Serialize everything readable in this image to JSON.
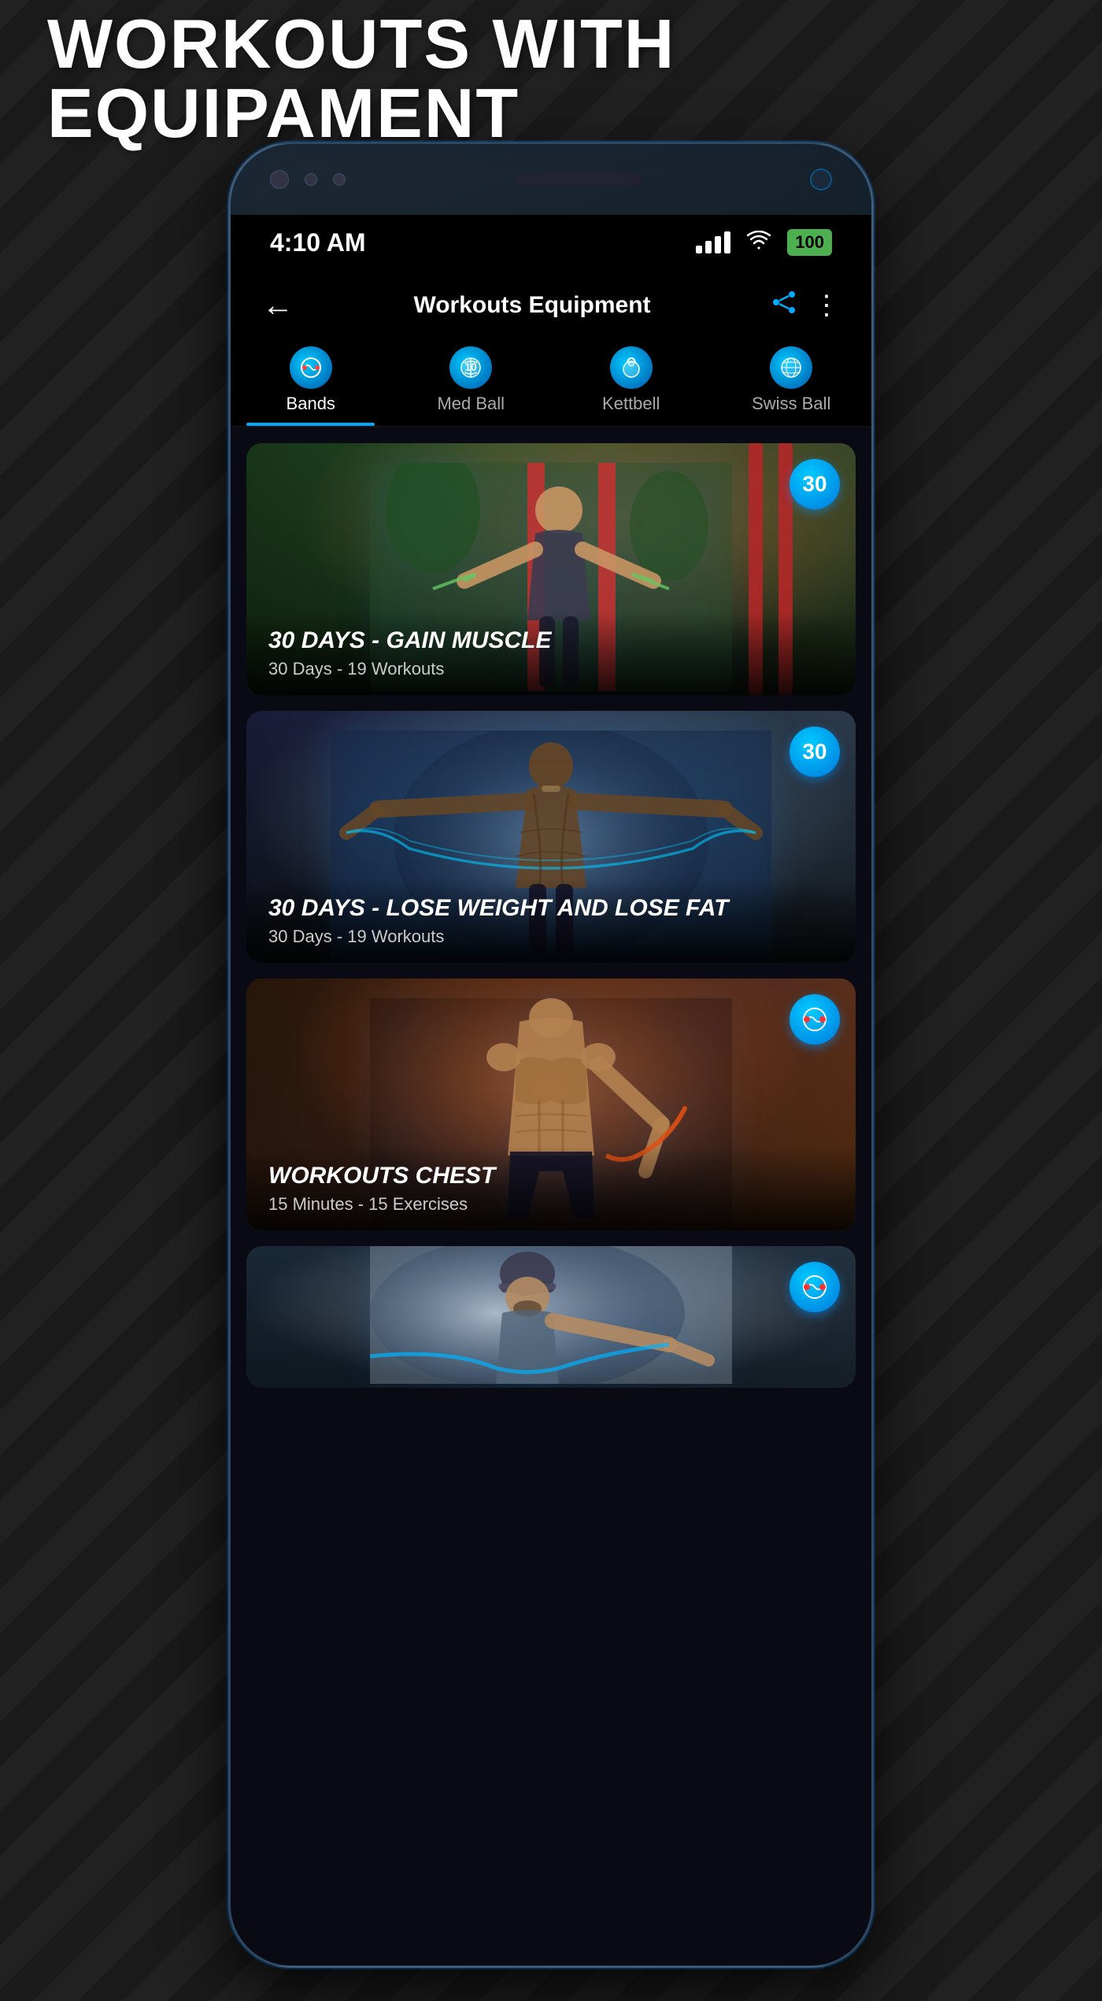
{
  "page": {
    "background_title": "WORKOUTS WITH EQUIPAMENT",
    "title_color": "#ffffff"
  },
  "status_bar": {
    "time": "4:10 AM",
    "battery": "100",
    "battery_color": "#4caf50"
  },
  "app_bar": {
    "title": "Workouts Equipment",
    "back_label": "←",
    "share_label": "⤷",
    "more_label": "⋮"
  },
  "tabs": [
    {
      "id": "bands",
      "label": "Bands",
      "active": true,
      "icon": "🏋"
    },
    {
      "id": "med-ball",
      "label": "Med Ball",
      "active": false,
      "icon": "⚽"
    },
    {
      "id": "kettbell",
      "label": "Kettbell",
      "active": false,
      "icon": "🔔"
    },
    {
      "id": "swiss-ball",
      "label": "Swiss Ball",
      "active": false,
      "icon": "🌐"
    }
  ],
  "workout_cards": [
    {
      "id": "gain-muscle",
      "title": "30 DAYS - GAIN MUSCLE",
      "subtitle": "30 Days - 19 Workouts",
      "badge_type": "number",
      "badge_value": "30",
      "theme": "outdoor"
    },
    {
      "id": "lose-weight",
      "title": "30 DAYS - LOSE WEIGHT AND LOSE FAT",
      "subtitle": "30 Days - 19 Workouts",
      "badge_type": "number",
      "badge_value": "30",
      "theme": "gray"
    },
    {
      "id": "chest",
      "title": "WORKOUTS CHEST",
      "subtitle": "15 Minutes - 15 Exercises",
      "badge_type": "icon",
      "badge_value": "🔴",
      "theme": "orange"
    },
    {
      "id": "partial",
      "title": "",
      "subtitle": "",
      "badge_type": "icon",
      "badge_value": "🔴",
      "theme": "gray-light",
      "partial": true
    }
  ],
  "icons": {
    "back": "←",
    "share": "⬆",
    "more": "⋮",
    "signal": "▌▌▌▌",
    "wifi": "wifi",
    "bands_tab": "🏋",
    "med_ball_tab": "⚽",
    "kettbell_tab": "🔔",
    "swiss_ball_tab": "🌐"
  }
}
